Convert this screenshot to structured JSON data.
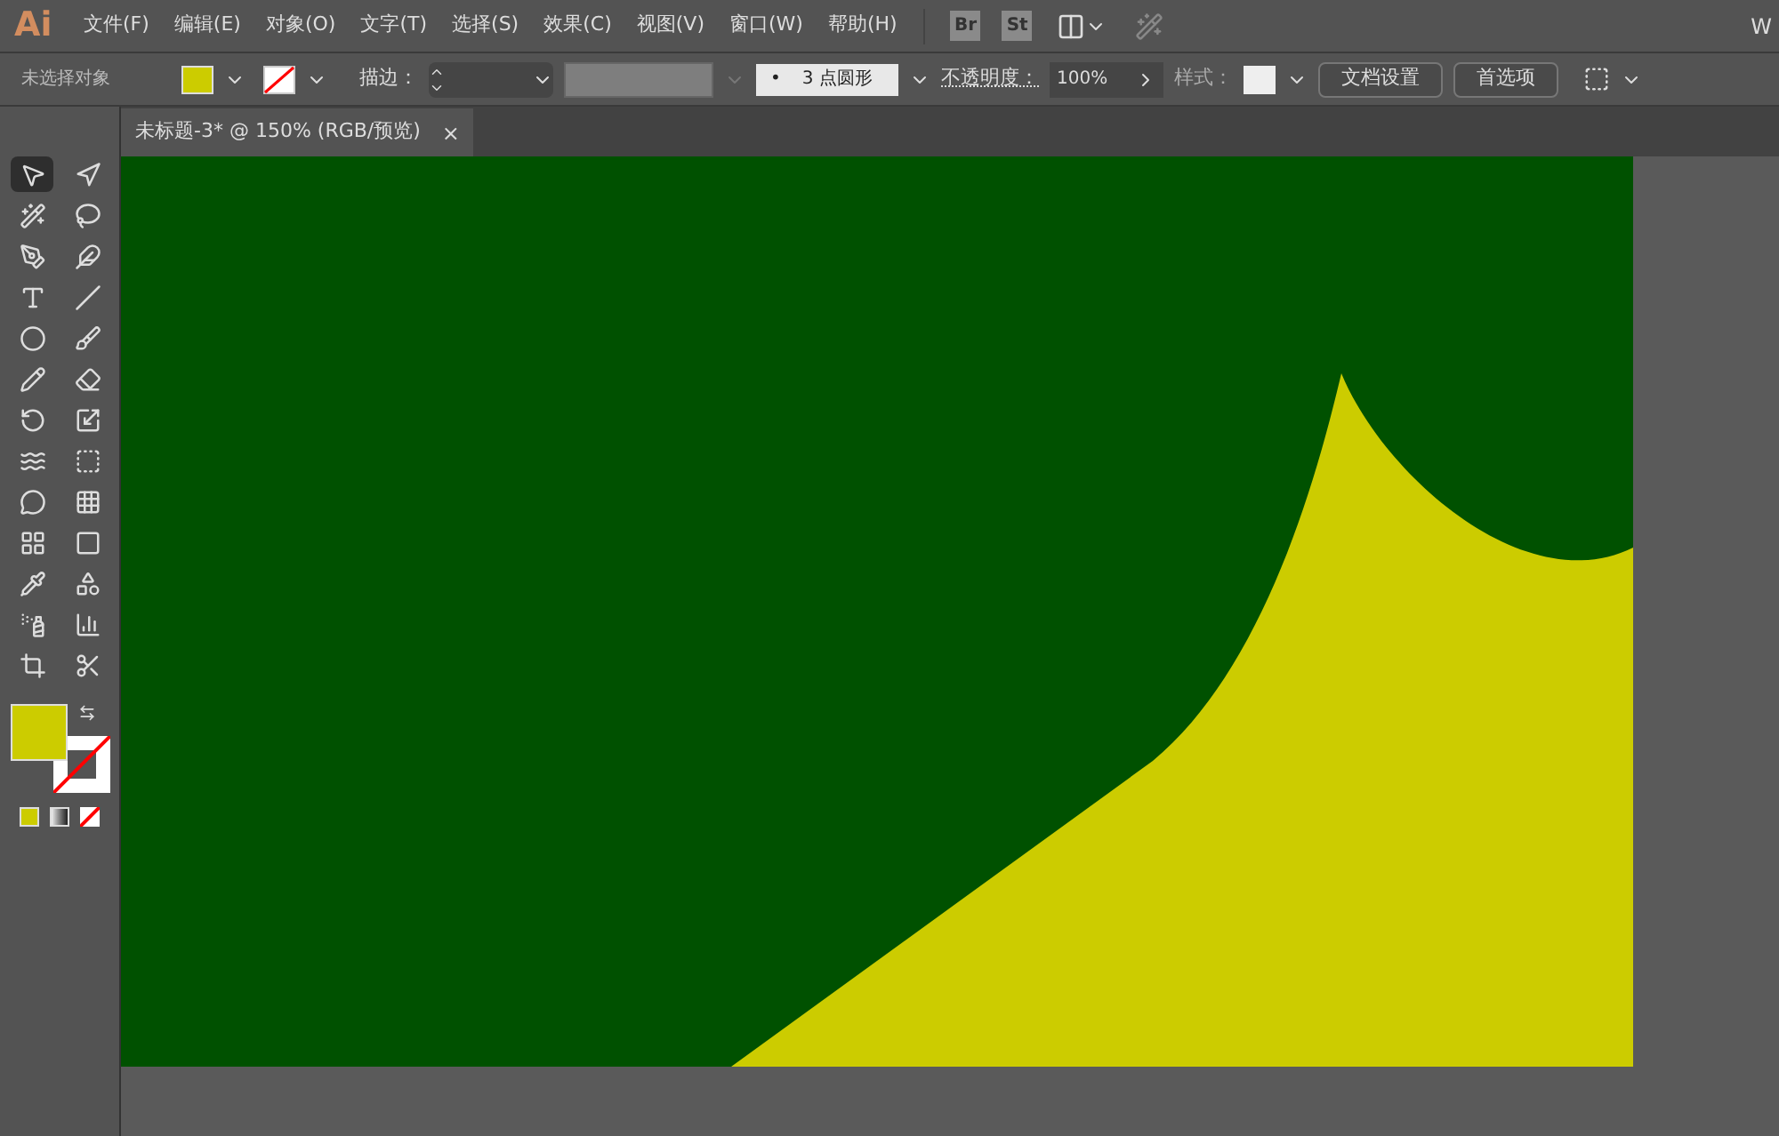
{
  "app_logo": "Ai",
  "menu": [
    "文件(F)",
    "编辑(E)",
    "对象(O)",
    "文字(T)",
    "选择(S)",
    "效果(C)",
    "视图(V)",
    "窗口(W)",
    "帮助(H)"
  ],
  "app_badges": [
    "Br",
    "St"
  ],
  "workspace": "W",
  "control_bar": {
    "selection": "未选择对象",
    "stroke_label": "描边：",
    "brush": "3 点圆形",
    "brush_dot": "•",
    "opacity_label": "不透明度：",
    "opacity": "100%",
    "style_label": "样式：",
    "buttons": [
      "文档设置",
      "首选项"
    ]
  },
  "document_tab": {
    "title": "未标题-3* @ 150% (RGB/预览)",
    "close": "×"
  },
  "tools": [
    {
      "selected": true
    },
    {
      "selected": false
    },
    {
      "selected": false
    },
    {
      "selected": false
    },
    {
      "selected": false
    },
    {
      "selected": false
    },
    {
      "selected": false
    },
    {
      "selected": false
    },
    {
      "selected": false
    },
    {
      "selected": false
    },
    {
      "selected": false
    },
    {
      "selected": false
    },
    {
      "selected": false
    },
    {
      "selected": false
    },
    {
      "selected": false
    },
    {
      "selected": false
    },
    {
      "selected": false
    },
    {
      "selected": false
    },
    {
      "selected": false
    },
    {
      "selected": false
    },
    {
      "selected": false
    },
    {
      "selected": false
    },
    {
      "selected": false
    },
    {
      "selected": false
    },
    {
      "selected": false
    },
    {
      "selected": false
    }
  ]
}
